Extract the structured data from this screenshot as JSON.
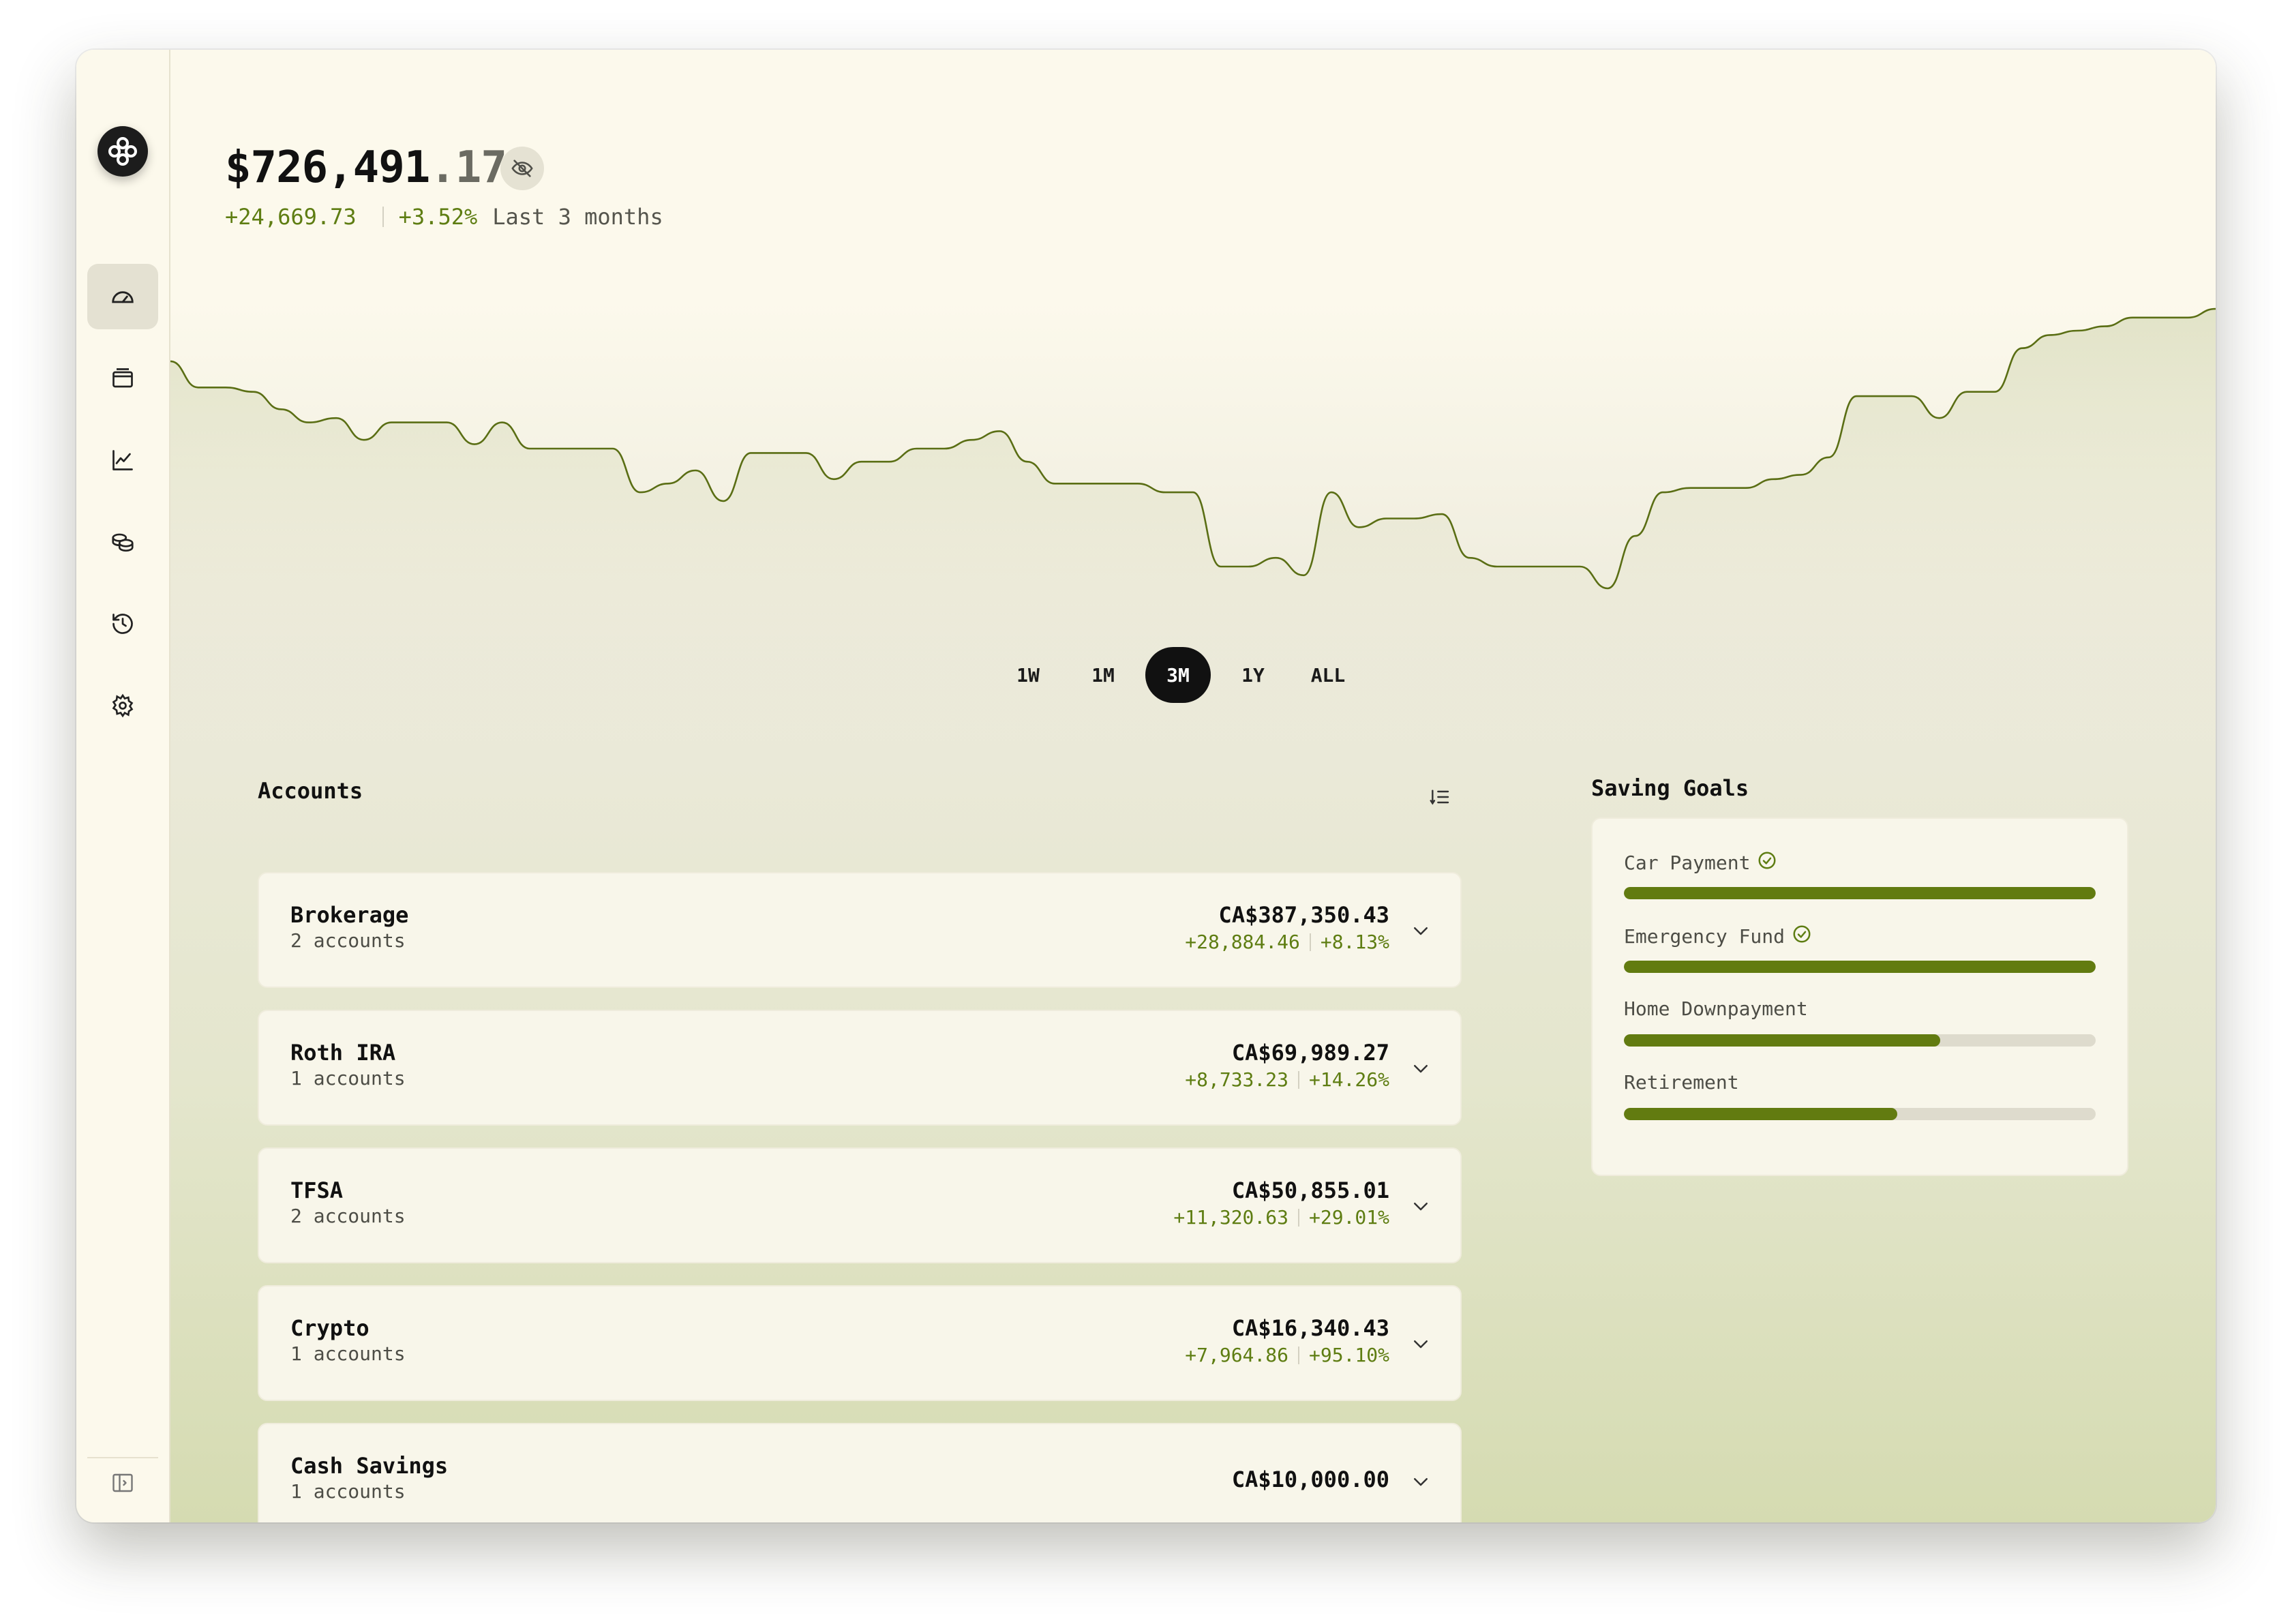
{
  "window": {
    "controls": [
      "close",
      "minimize",
      "zoom"
    ]
  },
  "sidebar": {
    "logo_icon": "app-logo-icon",
    "items": [
      {
        "id": "dashboard",
        "icon": "gauge-icon",
        "active": true
      },
      {
        "id": "wallet",
        "icon": "wallet-icon",
        "active": false
      },
      {
        "id": "performance",
        "icon": "chart-line-icon",
        "active": false
      },
      {
        "id": "holdings",
        "icon": "coins-icon",
        "active": false
      },
      {
        "id": "history",
        "icon": "history-icon",
        "active": false
      },
      {
        "id": "settings",
        "icon": "gear-icon",
        "active": false
      }
    ],
    "collapse_icon": "sidebar-toggle-icon"
  },
  "header": {
    "balance_main": "$726,491",
    "balance_cents": ".17",
    "hide_icon": "eye-off-icon",
    "change_amount": "+24,669.73",
    "change_percent": "+3.52%",
    "period_label": "Last 3 months"
  },
  "ranges": {
    "options": [
      "1W",
      "1M",
      "3M",
      "1Y",
      "ALL"
    ],
    "selected": "3M"
  },
  "accounts": {
    "title": "Accounts",
    "sort_icon": "list-sort-icon",
    "items": [
      {
        "name": "Brokerage",
        "sub": "2 accounts",
        "value": "CA$387,350.43",
        "change": "+28,884.46",
        "percent": "+8.13%"
      },
      {
        "name": "Roth IRA",
        "sub": "1 accounts",
        "value": "CA$69,989.27",
        "change": "+8,733.23",
        "percent": "+14.26%"
      },
      {
        "name": "TFSA",
        "sub": "2 accounts",
        "value": "CA$50,855.01",
        "change": "+11,320.63",
        "percent": "+29.01%"
      },
      {
        "name": "Crypto",
        "sub": "1 accounts",
        "value": "CA$16,340.43",
        "change": "+7,964.86",
        "percent": "+95.10%"
      },
      {
        "name": "Cash Savings",
        "sub": "1 accounts",
        "value": "CA$10,000.00",
        "change": "",
        "percent": ""
      }
    ]
  },
  "goals": {
    "title": "Saving Goals",
    "items": [
      {
        "name": "Car Payment",
        "progress": 1.0,
        "completed": true
      },
      {
        "name": "Emergency Fund",
        "progress": 1.0,
        "completed": true
      },
      {
        "name": "Home Downpayment",
        "progress": 0.67,
        "completed": false
      },
      {
        "name": "Retirement",
        "progress": 0.58,
        "completed": false
      }
    ]
  },
  "colors": {
    "accent": "#627b10",
    "positive": "#5e7d12",
    "background": "#fcf9ec",
    "line": "#5a6e14"
  },
  "chart_data": {
    "type": "area",
    "range": "3M",
    "values": [
      690,
      684,
      684,
      683,
      679,
      676,
      677,
      672,
      676,
      676,
      676,
      671,
      676,
      670,
      670,
      670,
      670,
      660,
      662,
      665,
      658,
      669,
      669,
      669,
      663,
      667,
      667,
      670,
      670,
      672,
      674,
      667,
      662,
      662,
      662,
      662,
      660,
      660,
      643,
      643,
      645,
      641,
      660,
      652,
      654,
      654,
      655,
      645,
      643,
      643,
      643,
      643,
      638,
      650,
      660,
      661,
      661,
      661,
      663,
      664,
      668,
      682,
      682,
      682,
      677,
      683,
      683,
      693,
      696,
      697,
      698,
      700,
      700,
      700,
      702
    ]
  }
}
